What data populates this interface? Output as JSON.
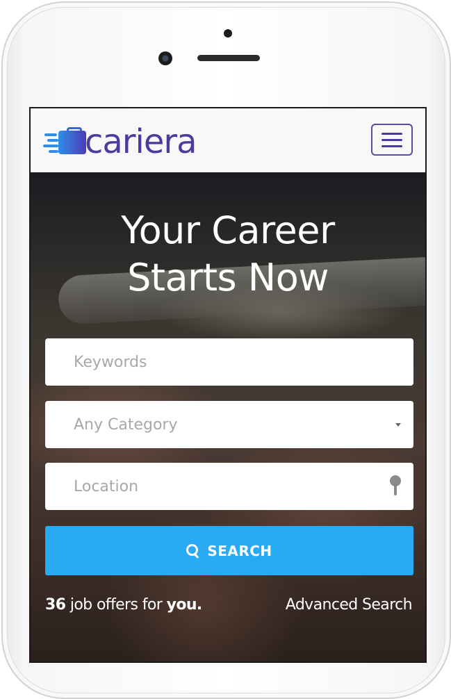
{
  "brand": {
    "name": "cariera",
    "logo_icon": "briefcase-speed-icon",
    "primary_color": "#4b3b9c",
    "accent_color": "#2f8fe6"
  },
  "navbar": {
    "menu_icon": "hamburger-menu-icon"
  },
  "hero": {
    "title_line1": "Your Career",
    "title_line2": "Starts Now"
  },
  "search_form": {
    "keywords_placeholder": "Keywords",
    "category_selected": "Any Category",
    "location_placeholder": "Location",
    "location_icon": "map-pin-icon",
    "category_icon": "caret-down-icon",
    "search_label": "SEARCH",
    "search_icon": "search-icon",
    "button_color": "#29aaf4"
  },
  "footer": {
    "job_count": "36",
    "offers_text": " job offers for ",
    "you_text": "you.",
    "advanced_search_label": "Advanced Search"
  }
}
